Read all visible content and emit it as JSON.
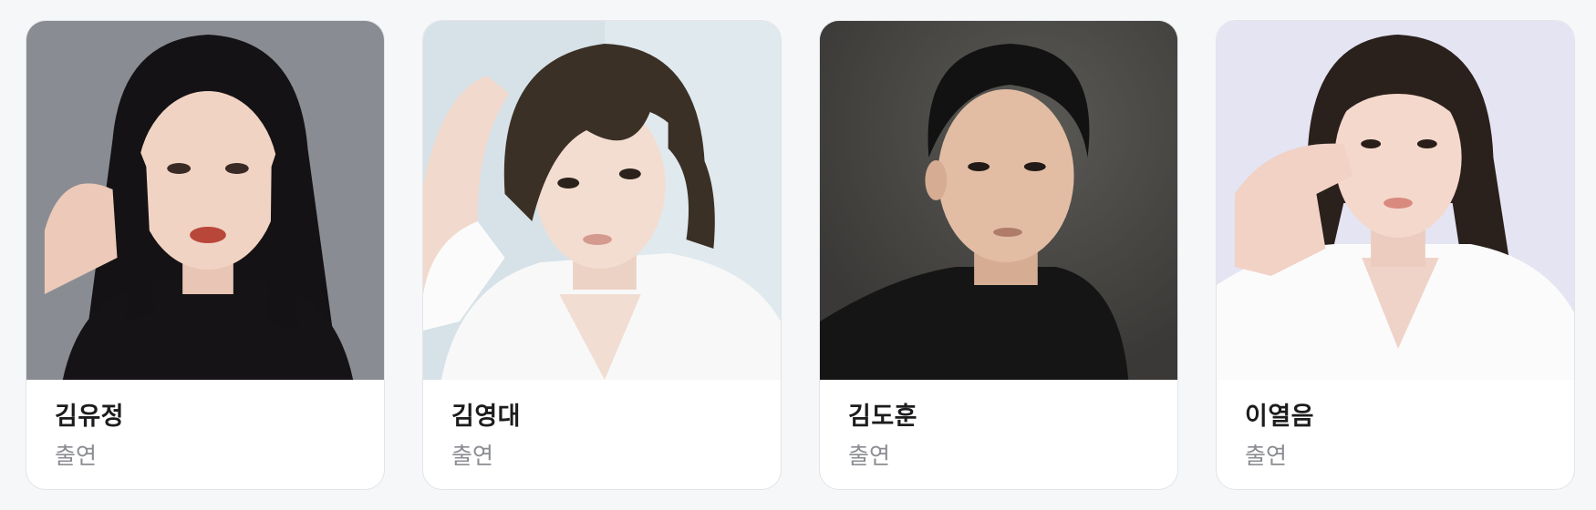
{
  "cast": [
    {
      "name": "김유정",
      "role": "출연",
      "bg": "#7c7f86",
      "hair": "#141214",
      "skin": "#f1d3c4",
      "shirt": "#151315"
    },
    {
      "name": "김영대",
      "role": "출연",
      "bg": "#d7e2e8",
      "hair": "#3a3026",
      "skin": "#f3ddd0",
      "shirt": "#f8f8f8"
    },
    {
      "name": "김도훈",
      "role": "출연",
      "bg": "#4a4946",
      "hair": "#121212",
      "skin": "#e2bda4",
      "shirt": "#151515"
    },
    {
      "name": "이열음",
      "role": "출연",
      "bg": "#e4e4f2",
      "hair": "#2a201c",
      "skin": "#f4d8cc",
      "shirt": "#fbfbfb"
    }
  ]
}
